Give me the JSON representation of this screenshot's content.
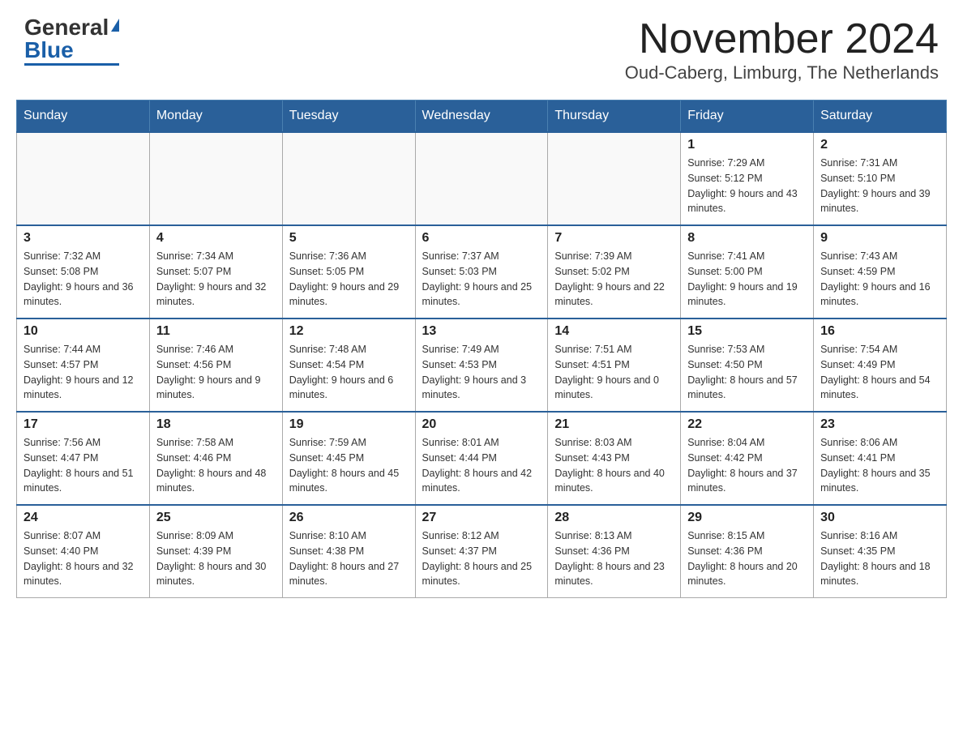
{
  "header": {
    "logo_general": "General",
    "logo_blue": "Blue",
    "month_title": "November 2024",
    "location": "Oud-Caberg, Limburg, The Netherlands"
  },
  "weekdays": [
    "Sunday",
    "Monday",
    "Tuesday",
    "Wednesday",
    "Thursday",
    "Friday",
    "Saturday"
  ],
  "weeks": [
    [
      {
        "day": "",
        "info": ""
      },
      {
        "day": "",
        "info": ""
      },
      {
        "day": "",
        "info": ""
      },
      {
        "day": "",
        "info": ""
      },
      {
        "day": "",
        "info": ""
      },
      {
        "day": "1",
        "info": "Sunrise: 7:29 AM\nSunset: 5:12 PM\nDaylight: 9 hours and 43 minutes."
      },
      {
        "day": "2",
        "info": "Sunrise: 7:31 AM\nSunset: 5:10 PM\nDaylight: 9 hours and 39 minutes."
      }
    ],
    [
      {
        "day": "3",
        "info": "Sunrise: 7:32 AM\nSunset: 5:08 PM\nDaylight: 9 hours and 36 minutes."
      },
      {
        "day": "4",
        "info": "Sunrise: 7:34 AM\nSunset: 5:07 PM\nDaylight: 9 hours and 32 minutes."
      },
      {
        "day": "5",
        "info": "Sunrise: 7:36 AM\nSunset: 5:05 PM\nDaylight: 9 hours and 29 minutes."
      },
      {
        "day": "6",
        "info": "Sunrise: 7:37 AM\nSunset: 5:03 PM\nDaylight: 9 hours and 25 minutes."
      },
      {
        "day": "7",
        "info": "Sunrise: 7:39 AM\nSunset: 5:02 PM\nDaylight: 9 hours and 22 minutes."
      },
      {
        "day": "8",
        "info": "Sunrise: 7:41 AM\nSunset: 5:00 PM\nDaylight: 9 hours and 19 minutes."
      },
      {
        "day": "9",
        "info": "Sunrise: 7:43 AM\nSunset: 4:59 PM\nDaylight: 9 hours and 16 minutes."
      }
    ],
    [
      {
        "day": "10",
        "info": "Sunrise: 7:44 AM\nSunset: 4:57 PM\nDaylight: 9 hours and 12 minutes."
      },
      {
        "day": "11",
        "info": "Sunrise: 7:46 AM\nSunset: 4:56 PM\nDaylight: 9 hours and 9 minutes."
      },
      {
        "day": "12",
        "info": "Sunrise: 7:48 AM\nSunset: 4:54 PM\nDaylight: 9 hours and 6 minutes."
      },
      {
        "day": "13",
        "info": "Sunrise: 7:49 AM\nSunset: 4:53 PM\nDaylight: 9 hours and 3 minutes."
      },
      {
        "day": "14",
        "info": "Sunrise: 7:51 AM\nSunset: 4:51 PM\nDaylight: 9 hours and 0 minutes."
      },
      {
        "day": "15",
        "info": "Sunrise: 7:53 AM\nSunset: 4:50 PM\nDaylight: 8 hours and 57 minutes."
      },
      {
        "day": "16",
        "info": "Sunrise: 7:54 AM\nSunset: 4:49 PM\nDaylight: 8 hours and 54 minutes."
      }
    ],
    [
      {
        "day": "17",
        "info": "Sunrise: 7:56 AM\nSunset: 4:47 PM\nDaylight: 8 hours and 51 minutes."
      },
      {
        "day": "18",
        "info": "Sunrise: 7:58 AM\nSunset: 4:46 PM\nDaylight: 8 hours and 48 minutes."
      },
      {
        "day": "19",
        "info": "Sunrise: 7:59 AM\nSunset: 4:45 PM\nDaylight: 8 hours and 45 minutes."
      },
      {
        "day": "20",
        "info": "Sunrise: 8:01 AM\nSunset: 4:44 PM\nDaylight: 8 hours and 42 minutes."
      },
      {
        "day": "21",
        "info": "Sunrise: 8:03 AM\nSunset: 4:43 PM\nDaylight: 8 hours and 40 minutes."
      },
      {
        "day": "22",
        "info": "Sunrise: 8:04 AM\nSunset: 4:42 PM\nDaylight: 8 hours and 37 minutes."
      },
      {
        "day": "23",
        "info": "Sunrise: 8:06 AM\nSunset: 4:41 PM\nDaylight: 8 hours and 35 minutes."
      }
    ],
    [
      {
        "day": "24",
        "info": "Sunrise: 8:07 AM\nSunset: 4:40 PM\nDaylight: 8 hours and 32 minutes."
      },
      {
        "day": "25",
        "info": "Sunrise: 8:09 AM\nSunset: 4:39 PM\nDaylight: 8 hours and 30 minutes."
      },
      {
        "day": "26",
        "info": "Sunrise: 8:10 AM\nSunset: 4:38 PM\nDaylight: 8 hours and 27 minutes."
      },
      {
        "day": "27",
        "info": "Sunrise: 8:12 AM\nSunset: 4:37 PM\nDaylight: 8 hours and 25 minutes."
      },
      {
        "day": "28",
        "info": "Sunrise: 8:13 AM\nSunset: 4:36 PM\nDaylight: 8 hours and 23 minutes."
      },
      {
        "day": "29",
        "info": "Sunrise: 8:15 AM\nSunset: 4:36 PM\nDaylight: 8 hours and 20 minutes."
      },
      {
        "day": "30",
        "info": "Sunrise: 8:16 AM\nSunset: 4:35 PM\nDaylight: 8 hours and 18 minutes."
      }
    ]
  ]
}
